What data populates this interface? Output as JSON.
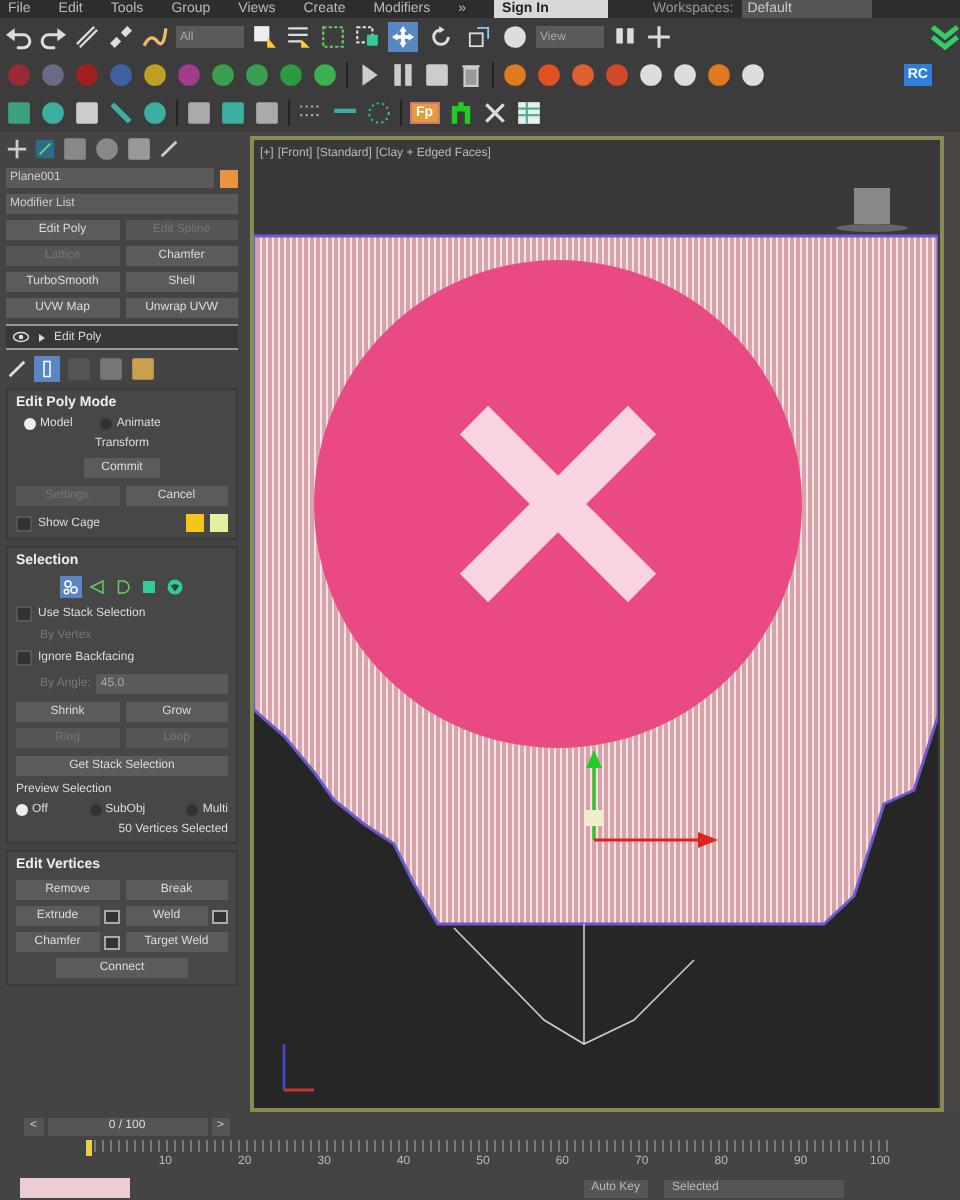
{
  "menu": [
    "File",
    "Edit",
    "Tools",
    "Group",
    "Views",
    "Create",
    "Modifiers",
    "»"
  ],
  "sign_in": "Sign In",
  "workspaces_label": "Workspaces:",
  "workspace": "Default",
  "toolbar": {
    "selection_filter": "All",
    "ref_coord": "View",
    "rc_badge": "RC",
    "fp_badge": "Fp",
    "transform_tools": [
      {
        "kind": "move",
        "selected": true
      },
      {
        "kind": "rotate",
        "selected": false
      },
      {
        "kind": "scale",
        "selected": false
      }
    ]
  },
  "command_panel": {
    "object_name": "Plane001",
    "modifier_list": "Modifier List",
    "modifier_buttons": [
      {
        "label": "Edit Poly",
        "disabled": false
      },
      {
        "label": "Edit Spline",
        "disabled": true
      },
      {
        "label": "Lattice",
        "disabled": true
      },
      {
        "label": "Chamfer",
        "disabled": false
      },
      {
        "label": "TurboSmooth",
        "disabled": false
      },
      {
        "label": "Shell",
        "disabled": false
      },
      {
        "label": "UVW Map",
        "disabled": false
      },
      {
        "label": "Unwrap UVW",
        "disabled": false
      }
    ],
    "stack_item": "Edit Poly",
    "show_end_result": true,
    "edit_poly_mode": {
      "title": "Edit Poly Mode",
      "modes": [
        {
          "label": "Model",
          "selected": true
        },
        {
          "label": "Animate",
          "selected": false
        }
      ],
      "transform_label": "Transform",
      "commit": "Commit",
      "settings": {
        "label": "Settings",
        "disabled": true
      },
      "cancel": "Cancel",
      "show_cage": {
        "label": "Show Cage",
        "checked": false
      },
      "cage_colors": [
        {
          "color": "#f5c518"
        },
        {
          "color": "#e2f0a0"
        }
      ]
    },
    "selection": {
      "title": "Selection",
      "levels": [
        {
          "kind": "vertex",
          "selected": true
        },
        {
          "kind": "edge",
          "selected": false
        },
        {
          "kind": "border",
          "selected": false
        },
        {
          "kind": "polygon",
          "selected": false
        },
        {
          "kind": "element",
          "selected": false
        }
      ],
      "use_stack": {
        "label": "Use Stack Selection",
        "checked": false
      },
      "by_vertex": {
        "label": "By Vertex",
        "disabled": true
      },
      "ignore_backfacing": {
        "label": "Ignore Backfacing",
        "checked": false
      },
      "by_angle": {
        "label": "By Angle:",
        "value": "45.0",
        "disabled": true
      },
      "shrink": "Shrink",
      "grow": "Grow",
      "ring": {
        "label": "Ring",
        "disabled": true
      },
      "loop": {
        "label": "Loop",
        "disabled": true
      },
      "get_stack": "Get Stack Selection",
      "preview": {
        "title": "Preview Selection",
        "options": [
          {
            "label": "Off",
            "selected": true
          },
          {
            "label": "SubObj",
            "selected": false
          },
          {
            "label": "Multi",
            "selected": false
          }
        ]
      },
      "status": "50 Vertices Selected"
    },
    "edit_vertices": {
      "title": "Edit Vertices",
      "buttons": [
        {
          "label": "Remove",
          "settings": false
        },
        {
          "label": "Break",
          "settings": false
        },
        {
          "label": "Extrude",
          "settings": true
        },
        {
          "label": "Weld",
          "settings": true
        },
        {
          "label": "Chamfer",
          "settings": true
        },
        {
          "label": "Target Weld",
          "settings": false
        },
        {
          "label": "Connect",
          "settings": false
        }
      ]
    }
  },
  "viewport": {
    "labels": [
      "[+]",
      "[Front]",
      "[Standard]",
      "[Clay + Edged Faces]"
    ]
  },
  "time_slider": {
    "prev": "<",
    "frame": "0 / 100",
    "next": ">",
    "level": 0
  },
  "timeline": {
    "level": 0,
    "ticks": [
      "10",
      "20",
      "30",
      "40",
      "50",
      "60",
      "70",
      "80",
      "90",
      "100"
    ]
  },
  "status_bar": {
    "auto_key": "Auto Key",
    "key_filter": "Selected"
  }
}
